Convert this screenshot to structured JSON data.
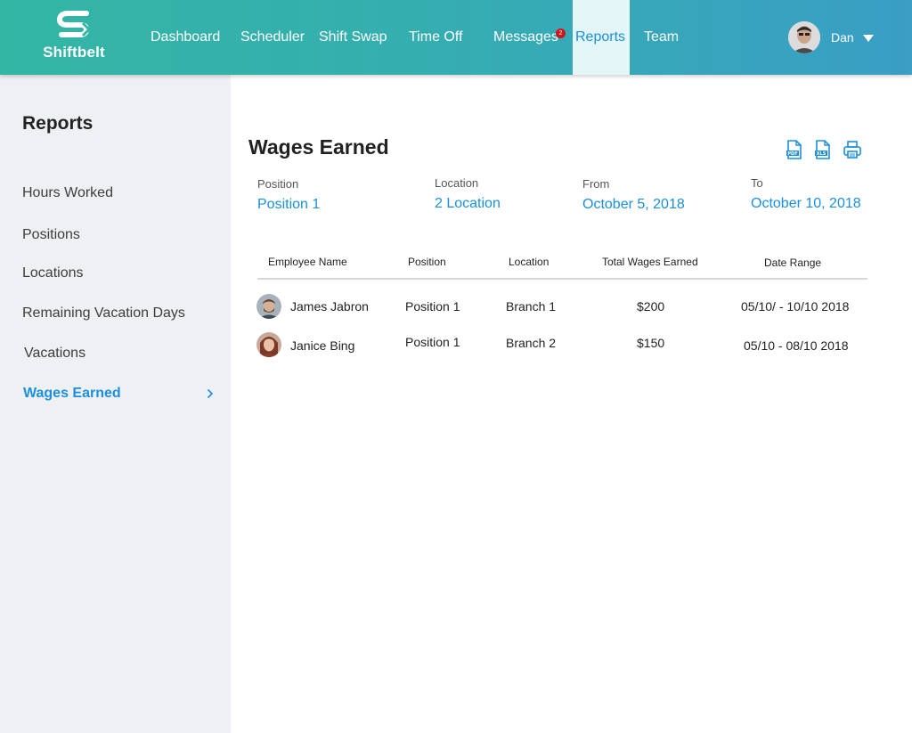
{
  "brand": {
    "name": "Shiftbelt"
  },
  "nav": {
    "items": [
      {
        "label": "Dashboard"
      },
      {
        "label": "Scheduler"
      },
      {
        "label": "Shift Swap"
      },
      {
        "label": "Time Off"
      },
      {
        "label": "Messages",
        "badge": "2"
      },
      {
        "label": "Reports"
      },
      {
        "label": "Team"
      }
    ],
    "active": "Reports"
  },
  "user": {
    "name": "Dan"
  },
  "sidebar": {
    "title": "Reports",
    "items": [
      {
        "label": "Hours Worked"
      },
      {
        "label": "Positions"
      },
      {
        "label": "Locations"
      },
      {
        "label": "Remaining Vacation Days"
      },
      {
        "label": "Vacations"
      },
      {
        "label": "Wages Earned"
      }
    ],
    "active": "Wages Earned"
  },
  "main": {
    "title": "Wages Earned",
    "tools": [
      "pdf-icon",
      "xls-icon",
      "print-icon"
    ],
    "filters": {
      "position": {
        "label": "Position",
        "value": "Position 1"
      },
      "location": {
        "label": "Location",
        "value": "2 Location"
      },
      "from": {
        "label": "From",
        "value": "October 5, 2018"
      },
      "to": {
        "label": "To",
        "value": "October 10, 2018"
      }
    },
    "table": {
      "headers": [
        "Employee Name",
        "Position",
        "Location",
        "Total Wages Earned",
        "Date Range"
      ],
      "rows": [
        {
          "name": "James Jabron",
          "position": "Position 1",
          "location": "Branch 1",
          "wages": "$200",
          "range": "05/10/ - 10/10 2018"
        },
        {
          "name": "Janice Bing",
          "position": "Position 1",
          "location": "Branch 2",
          "wages": "$150",
          "range": "05/10 - 08/10 2018"
        }
      ]
    }
  },
  "colors": {
    "accent": "#1a8fe0",
    "topbar_start": "#33b6a4",
    "topbar_end": "#3a9ec5",
    "badge": "#d0141b"
  }
}
